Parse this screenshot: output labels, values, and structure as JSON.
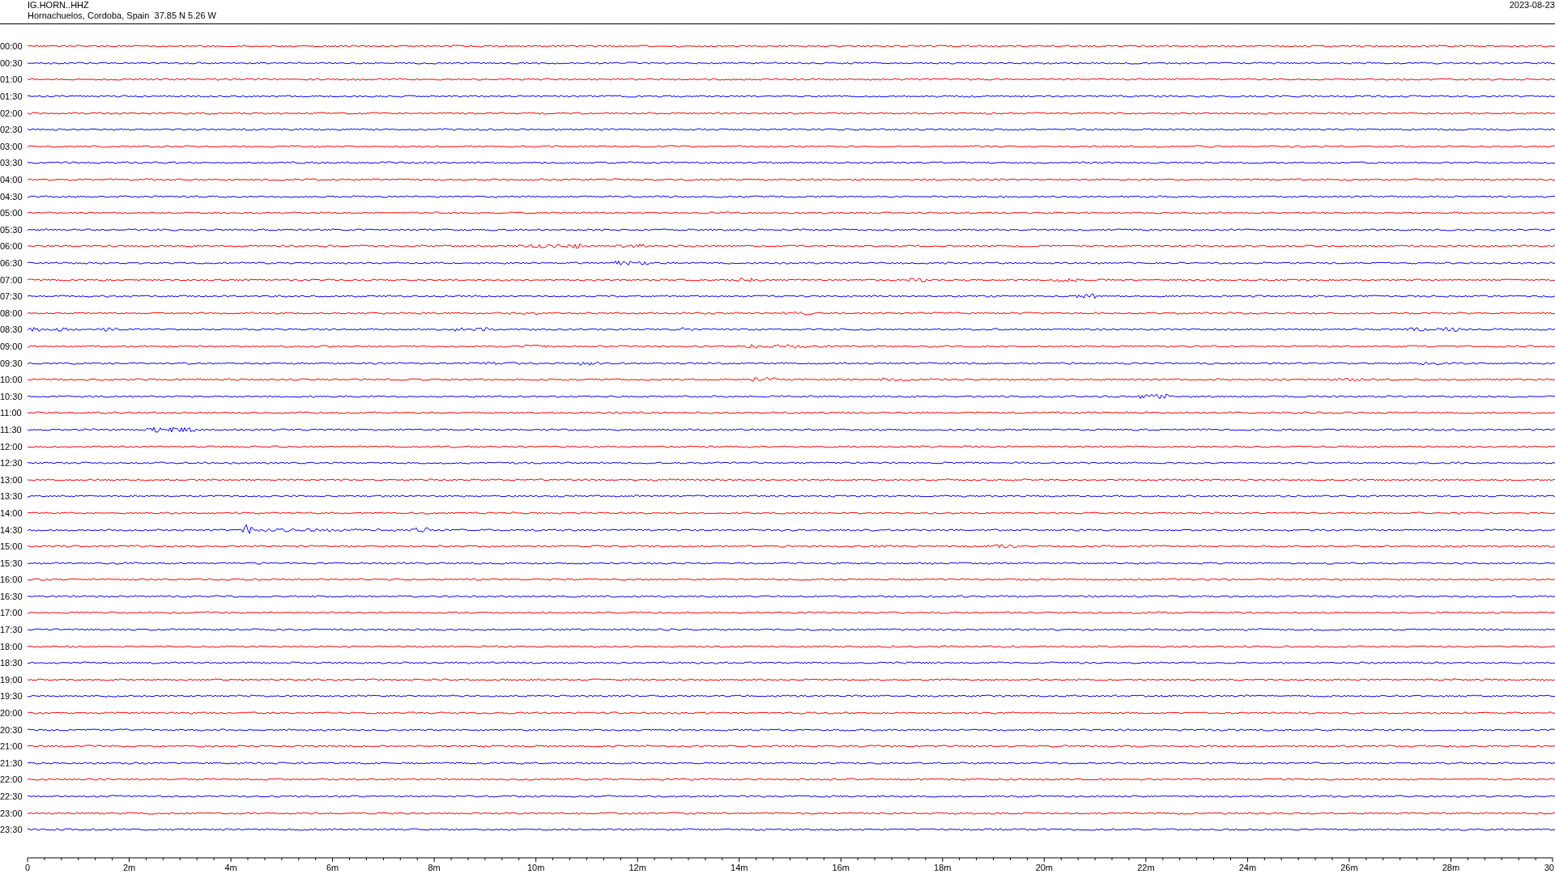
{
  "header": {
    "station": "IG.HORN..HHZ",
    "location": "Hornachuelos, Cordoba, Spain  37.85 N 5.26 W",
    "date": "2023-08-23"
  },
  "traces": [
    {
      "time": "00:00",
      "color": "#ff0000"
    },
    {
      "time": "00:30",
      "color": "#0000ff"
    },
    {
      "time": "01:00",
      "color": "#ff0000"
    },
    {
      "time": "01:30",
      "color": "#0000ff"
    },
    {
      "time": "02:00",
      "color": "#ff0000"
    },
    {
      "time": "02:30",
      "color": "#0000ff"
    },
    {
      "time": "03:00",
      "color": "#ff0000"
    },
    {
      "time": "03:30",
      "color": "#0000ff"
    },
    {
      "time": "04:00",
      "color": "#ff0000"
    },
    {
      "time": "04:30",
      "color": "#0000ff"
    },
    {
      "time": "05:00",
      "color": "#ff0000"
    },
    {
      "time": "05:30",
      "color": "#0000ff"
    },
    {
      "time": "06:00",
      "color": "#ff0000"
    },
    {
      "time": "06:30",
      "color": "#0000ff"
    },
    {
      "time": "07:00",
      "color": "#ff0000"
    },
    {
      "time": "07:30",
      "color": "#0000ff"
    },
    {
      "time": "08:00",
      "color": "#ff0000"
    },
    {
      "time": "08:30",
      "color": "#0000ff"
    },
    {
      "time": "09:00",
      "color": "#ff0000"
    },
    {
      "time": "09:30",
      "color": "#0000ff"
    },
    {
      "time": "10:00",
      "color": "#ff0000"
    },
    {
      "time": "10:30",
      "color": "#0000ff"
    },
    {
      "time": "11:00",
      "color": "#ff0000"
    },
    {
      "time": "11:30",
      "color": "#0000ff"
    },
    {
      "time": "12:00",
      "color": "#ff0000"
    },
    {
      "time": "12:30",
      "color": "#0000ff"
    },
    {
      "time": "13:00",
      "color": "#ff0000"
    },
    {
      "time": "13:30",
      "color": "#0000ff"
    },
    {
      "time": "14:00",
      "color": "#ff0000"
    },
    {
      "time": "14:30",
      "color": "#0000ff"
    },
    {
      "time": "15:00",
      "color": "#ff0000"
    },
    {
      "time": "15:30",
      "color": "#0000ff"
    },
    {
      "time": "16:00",
      "color": "#ff0000"
    },
    {
      "time": "16:30",
      "color": "#0000ff"
    },
    {
      "time": "17:00",
      "color": "#ff0000"
    },
    {
      "time": "17:30",
      "color": "#0000ff"
    },
    {
      "time": "18:00",
      "color": "#ff0000"
    },
    {
      "time": "18:30",
      "color": "#0000ff"
    },
    {
      "time": "19:00",
      "color": "#ff0000"
    },
    {
      "time": "19:30",
      "color": "#0000ff"
    },
    {
      "time": "20:00",
      "color": "#ff0000"
    },
    {
      "time": "20:30",
      "color": "#0000ff"
    },
    {
      "time": "21:00",
      "color": "#ff0000"
    },
    {
      "time": "21:30",
      "color": "#0000ff"
    },
    {
      "time": "22:00",
      "color": "#ff0000"
    },
    {
      "time": "22:30",
      "color": "#0000ff"
    },
    {
      "time": "23:00",
      "color": "#ff0000"
    },
    {
      "time": "23:30",
      "color": "#0000ff"
    }
  ],
  "x_axis": {
    "ticks": [
      "0",
      "2m",
      "4m",
      "6m",
      "8m",
      "10m",
      "12m",
      "14m",
      "16m",
      "18m",
      "20m",
      "22m",
      "24m",
      "26m",
      "28m",
      "30"
    ]
  }
}
